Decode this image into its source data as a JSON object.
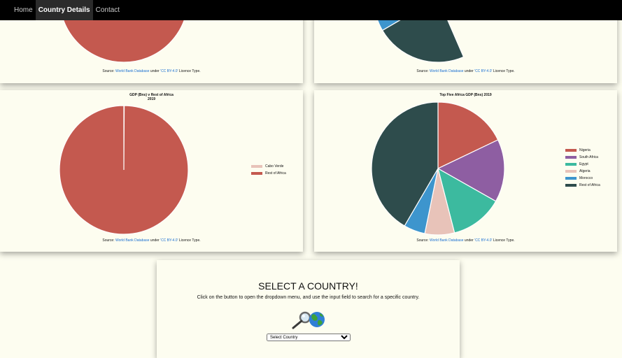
{
  "nav": {
    "items": [
      {
        "label": "Home",
        "active": false
      },
      {
        "label": "Country Details",
        "active": true
      },
      {
        "label": "Contact",
        "active": false
      }
    ]
  },
  "source": {
    "prefix": "Source: ",
    "db_link": "World Bank Database",
    "middle": " under ",
    "license_link": "'CC BY-4.0'",
    "suffix": " Licence Type."
  },
  "colors": {
    "nigeria": "#c4594f",
    "south_africa": "#8e5ea2",
    "egypt": "#3cba9f",
    "algeria": "#e8c3b9",
    "morocco": "#3d95cd",
    "rest": "#2e4c4c"
  },
  "select_section": {
    "title": "SELECT A COUNTRY!",
    "instructions": "Click on the button to open the dropdown menu, and use the input field to search for a specific country.",
    "icons": [
      "magnifier-icon",
      "globe-icon"
    ],
    "select_value": "Select Country"
  },
  "chart_data": [
    {
      "type": "pie",
      "title": "",
      "labels": [],
      "values": [
        1
      ],
      "colors": [
        "#c4594f"
      ]
    },
    {
      "type": "pie",
      "title": "",
      "labels": [],
      "values": [],
      "colors": [
        "#2e4c4c",
        "#3d95cd",
        "#e8c3b9"
      ]
    },
    {
      "type": "pie",
      "title": "GDP (Bns) v Rest of Africa",
      "subtitle": "2019",
      "labels": [
        "Cabo Verde",
        "Rest of Africa"
      ],
      "values": [
        0.1,
        99.9
      ],
      "colors": [
        "#e8c3b9",
        "#c4594f"
      ],
      "legend": "right"
    },
    {
      "type": "pie",
      "title": "Top Five Africa GDP (Bns) 2019",
      "labels": [
        "Nigeria",
        "South Africa",
        "Egypt",
        "Algeria",
        "Morocco",
        "Rest of Africa"
      ],
      "values": [
        17.9,
        15.3,
        12.8,
        7.2,
        5.2,
        41.6
      ],
      "colors": [
        "#c4594f",
        "#8e5ea2",
        "#3cba9f",
        "#e8c3b9",
        "#3d95cd",
        "#2e4c4c"
      ],
      "legend": "right"
    }
  ]
}
